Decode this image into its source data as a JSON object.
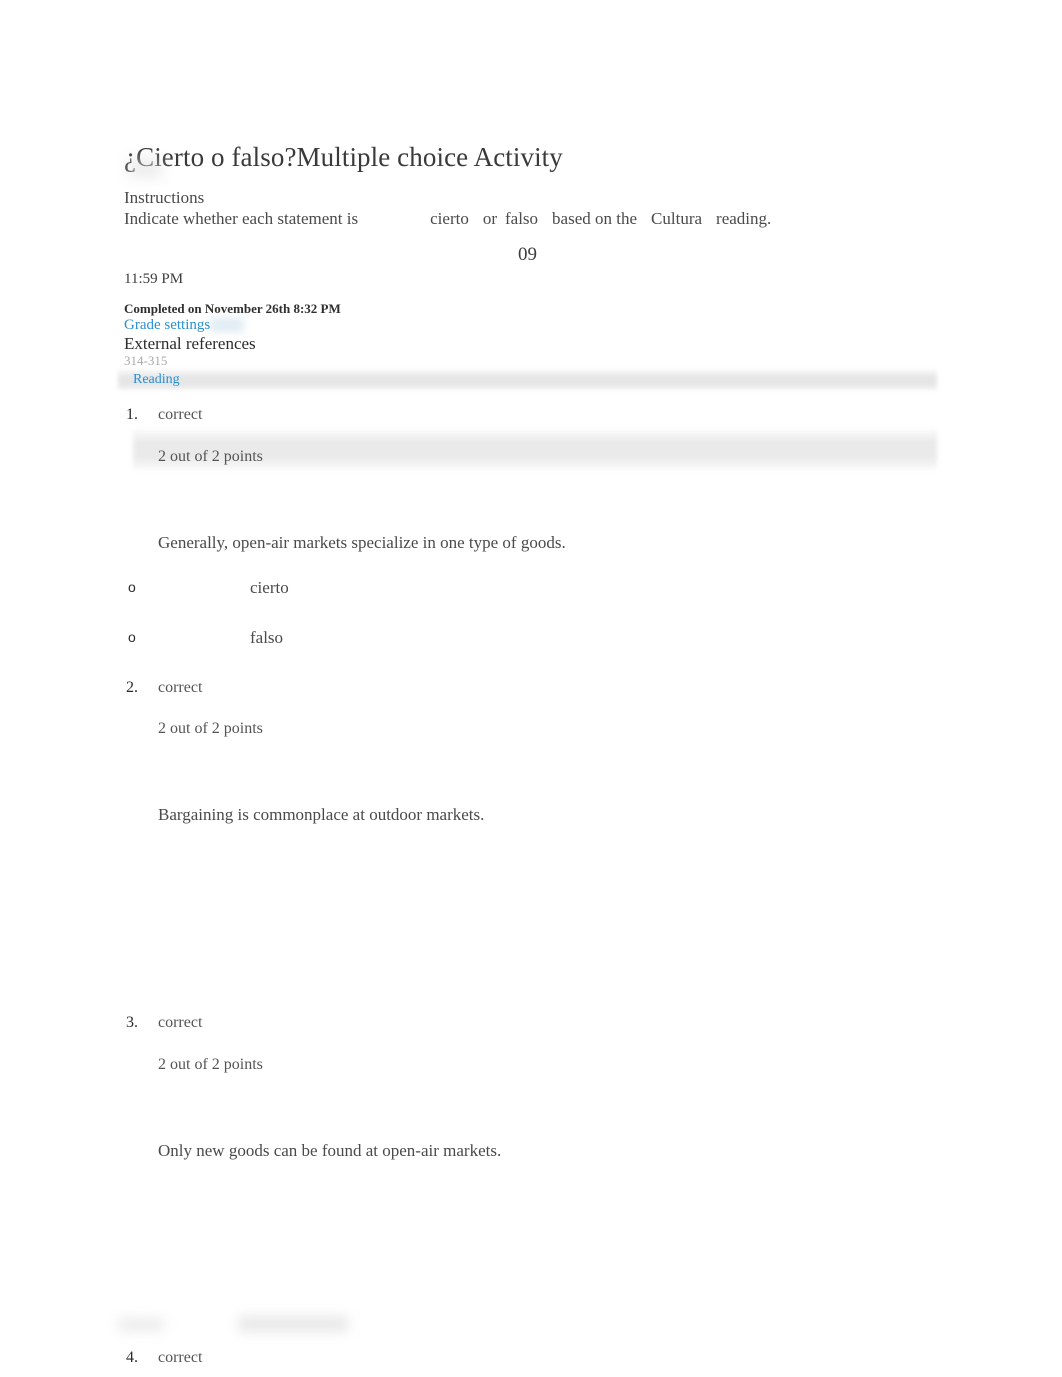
{
  "document": {
    "title": "¿Cierto o falso?Multiple choice Activity"
  },
  "instructions": {
    "heading": "Instructions",
    "text_part1": "Indicate whether each statement is",
    "term_cierto": "cierto",
    "conjunction": "or",
    "term_falso": "falso",
    "text_part2": "based on the",
    "term_cultura": "Cultura",
    "text_part3": "reading."
  },
  "meta": {
    "due_number": "09",
    "due_time": "11:59 PM",
    "completed_on": "Completed on November 26th 8:32 PM",
    "grade_settings_link": "Grade settings",
    "external_references_heading": "External references",
    "reference_pages": "314-315",
    "reading_link": "Reading"
  },
  "questions": [
    {
      "number": "1.",
      "status": "correct",
      "points": "2 out of 2 points",
      "statement": "Generally, open-air markets specialize in one type of goods.",
      "options": [
        {
          "marker": "o",
          "label": "cierto"
        },
        {
          "marker": "o",
          "label": "falso"
        }
      ]
    },
    {
      "number": "2.",
      "status": "correct",
      "points": "2 out of 2 points",
      "statement": "Bargaining is commonplace at outdoor markets.",
      "options": []
    },
    {
      "number": "3.",
      "status": "correct",
      "points": "2 out of 2 points",
      "statement": "Only new goods can be found at open-air markets.",
      "options": []
    },
    {
      "number": "4.",
      "status": "correct",
      "points": "",
      "statement": "",
      "options": []
    }
  ],
  "colors": {
    "link": "#2a8fd4",
    "text": "#4a4a4a",
    "muted": "#a9a9a9",
    "band": "#e9e9e9"
  }
}
